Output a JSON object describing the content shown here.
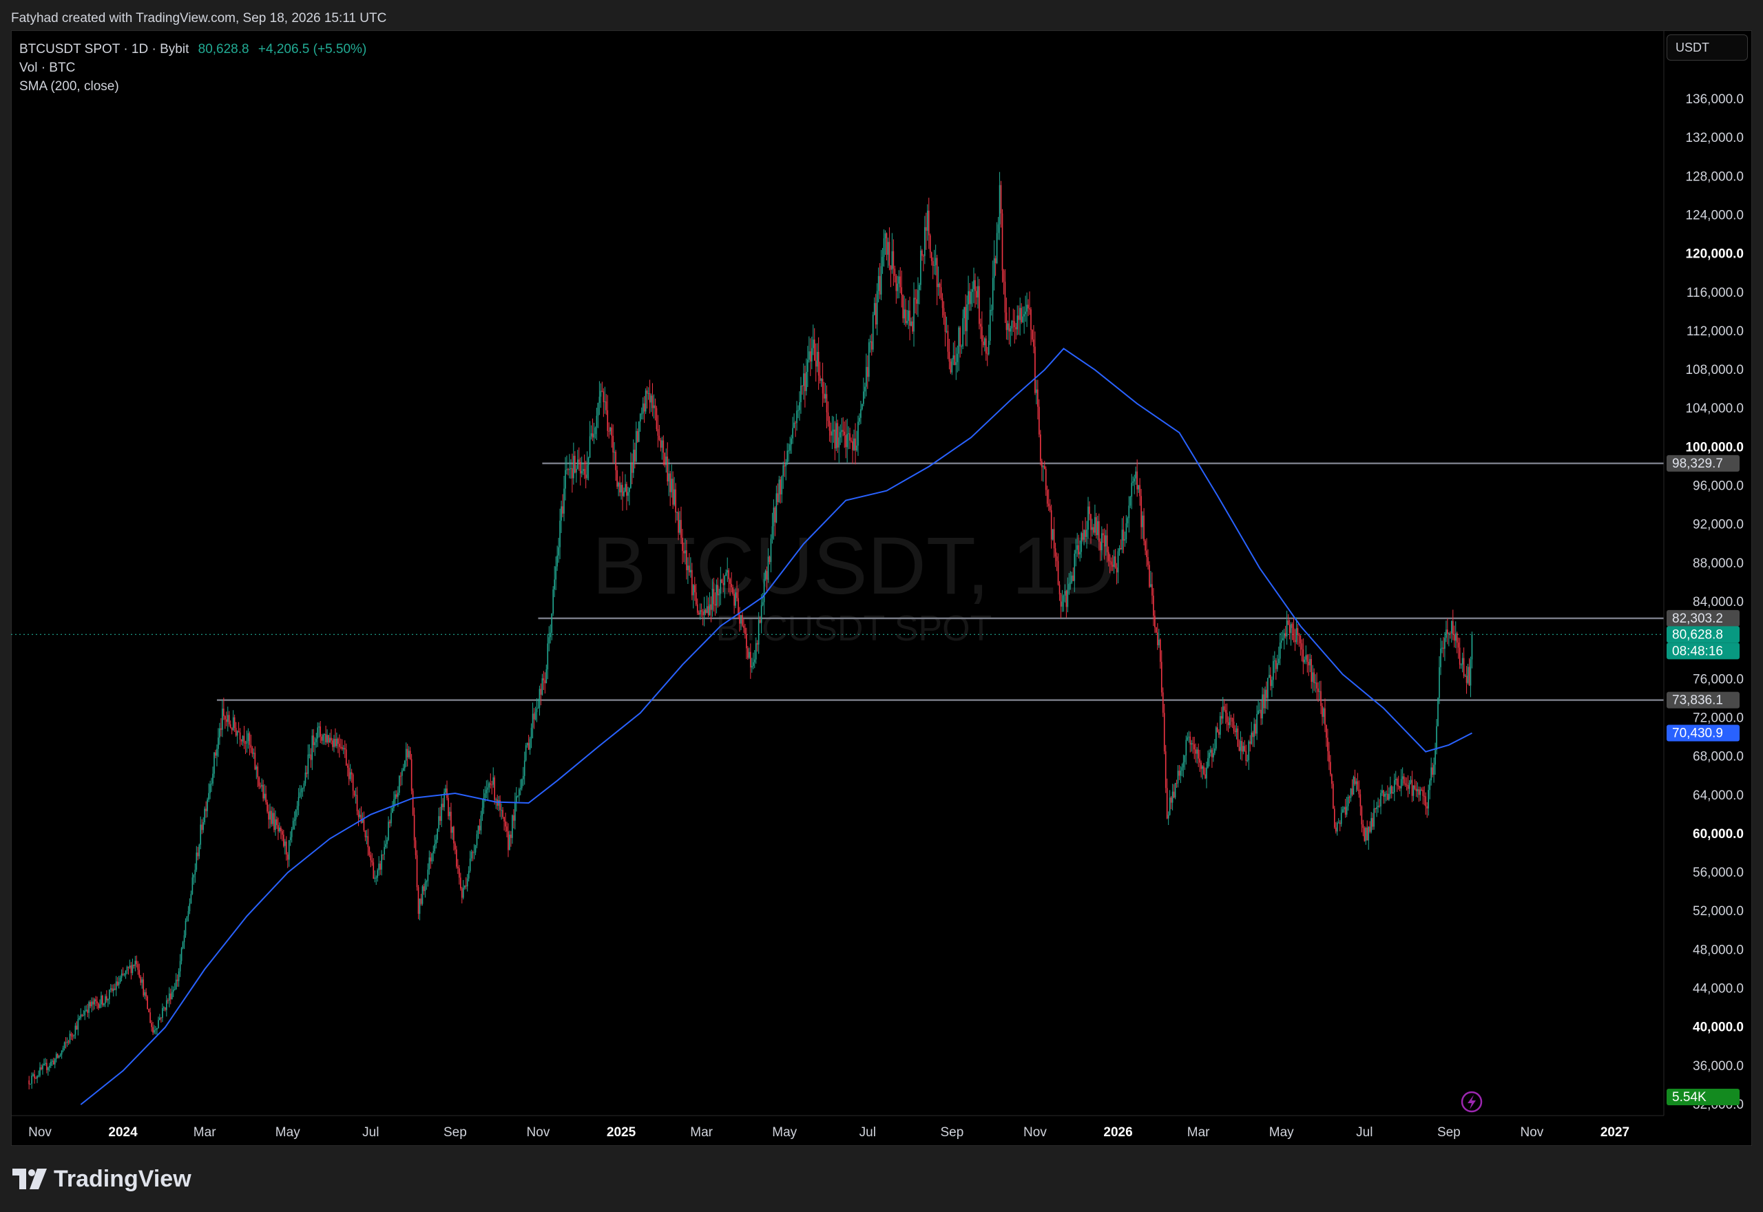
{
  "header": {
    "credit": "Fatyhad created with TradingView.com, Sep 18, 2026 15:11 UTC"
  },
  "legend": {
    "symbol": "BTCUSDT SPOT · 1D · Bybit",
    "last": "80,628.8",
    "change": "+4,206.5 (+5.50%)",
    "vol": "Vol · BTC",
    "sma": "SMA (200, close)"
  },
  "currency": "USDT",
  "watermark": {
    "line1": "BTCUSDT, 1D",
    "line2": "BTCUSDT SPOT"
  },
  "brand": {
    "name": "TradingView"
  },
  "colors": {
    "up": "#22ab94",
    "down": "#f23645",
    "sma": "#2962ff",
    "last_label": "#089981",
    "grid_line": "#787b86"
  },
  "chart_data": {
    "type": "candlestick",
    "ylim": [
      32000,
      140000
    ],
    "y_ticks": [
      {
        "v": 32000,
        "label": "32,000.0",
        "bold": false
      },
      {
        "v": 36000,
        "label": "36,000.0",
        "bold": false
      },
      {
        "v": 40000,
        "label": "40,000.0",
        "bold": true
      },
      {
        "v": 44000,
        "label": "44,000.0",
        "bold": false
      },
      {
        "v": 48000,
        "label": "48,000.0",
        "bold": false
      },
      {
        "v": 52000,
        "label": "52,000.0",
        "bold": false
      },
      {
        "v": 56000,
        "label": "56,000.0",
        "bold": false
      },
      {
        "v": 60000,
        "label": "60,000.0",
        "bold": true
      },
      {
        "v": 64000,
        "label": "64,000.0",
        "bold": false
      },
      {
        "v": 68000,
        "label": "68,000.0",
        "bold": false
      },
      {
        "v": 72000,
        "label": "72,000.0",
        "bold": false
      },
      {
        "v": 76000,
        "label": "76,000.0",
        "bold": false
      },
      {
        "v": 84000,
        "label": "84,000.0",
        "bold": false
      },
      {
        "v": 88000,
        "label": "88,000.0",
        "bold": false
      },
      {
        "v": 92000,
        "label": "92,000.0",
        "bold": false
      },
      {
        "v": 96000,
        "label": "96,000.0",
        "bold": false
      },
      {
        "v": 100000,
        "label": "100,000.0",
        "bold": true
      },
      {
        "v": 104000,
        "label": "104,000.0",
        "bold": false
      },
      {
        "v": 108000,
        "label": "108,000.0",
        "bold": false
      },
      {
        "v": 112000,
        "label": "112,000.0",
        "bold": false
      },
      {
        "v": 116000,
        "label": "116,000.0",
        "bold": false
      },
      {
        "v": 120000,
        "label": "120,000.0",
        "bold": true
      },
      {
        "v": 124000,
        "label": "124,000.0",
        "bold": false
      },
      {
        "v": 128000,
        "label": "128,000.0",
        "bold": false
      },
      {
        "v": 132000,
        "label": "132,000.0",
        "bold": false
      },
      {
        "v": 136000,
        "label": "136,000.0",
        "bold": false
      }
    ],
    "x_ticks": [
      {
        "date": "2023-11-01",
        "label": "Nov",
        "bold": false
      },
      {
        "date": "2024-01-01",
        "label": "2024",
        "bold": true
      },
      {
        "date": "2024-03-01",
        "label": "Mar",
        "bold": false
      },
      {
        "date": "2024-05-01",
        "label": "May",
        "bold": false
      },
      {
        "date": "2024-07-01",
        "label": "Jul",
        "bold": false
      },
      {
        "date": "2024-09-01",
        "label": "Sep",
        "bold": false
      },
      {
        "date": "2024-11-01",
        "label": "Nov",
        "bold": false
      },
      {
        "date": "2025-01-01",
        "label": "2025",
        "bold": true
      },
      {
        "date": "2025-03-01",
        "label": "Mar",
        "bold": false
      },
      {
        "date": "2025-05-01",
        "label": "May",
        "bold": false
      },
      {
        "date": "2025-07-01",
        "label": "Jul",
        "bold": false
      },
      {
        "date": "2025-09-01",
        "label": "Sep",
        "bold": false
      },
      {
        "date": "2025-11-01",
        "label": "Nov",
        "bold": false
      },
      {
        "date": "2026-01-01",
        "label": "2026",
        "bold": true
      },
      {
        "date": "2026-03-01",
        "label": "Mar",
        "bold": false
      },
      {
        "date": "2026-05-01",
        "label": "May",
        "bold": false
      },
      {
        "date": "2026-07-01",
        "label": "Jul",
        "bold": false
      },
      {
        "date": "2026-09-01",
        "label": "Sep",
        "bold": false
      },
      {
        "date": "2026-11-01",
        "label": "Nov",
        "bold": false
      },
      {
        "date": "2027-01-01",
        "label": "2027",
        "bold": true
      }
    ],
    "x_range": [
      "2023-10-22",
      "2027-01-15"
    ],
    "price_path": [
      [
        "2023-10-24",
        34500
      ],
      [
        "2023-11-15",
        37000
      ],
      [
        "2023-12-05",
        42000
      ],
      [
        "2023-12-20",
        43000
      ],
      [
        "2024-01-11",
        47000
      ],
      [
        "2024-01-23",
        39500
      ],
      [
        "2024-02-10",
        45000
      ],
      [
        "2024-02-28",
        61000
      ],
      [
        "2024-03-14",
        72000
      ],
      [
        "2024-04-01",
        70000
      ],
      [
        "2024-04-15",
        63000
      ],
      [
        "2024-05-01",
        58000
      ],
      [
        "2024-05-21",
        70500
      ],
      [
        "2024-06-10",
        69500
      ],
      [
        "2024-07-05",
        55000
      ],
      [
        "2024-07-29",
        69500
      ],
      [
        "2024-08-05",
        52000
      ],
      [
        "2024-08-25",
        64500
      ],
      [
        "2024-09-06",
        53500
      ],
      [
        "2024-09-27",
        66000
      ],
      [
        "2024-10-10",
        59000
      ],
      [
        "2024-10-29",
        72500
      ],
      [
        "2024-11-06",
        76000
      ],
      [
        "2024-11-22",
        98500
      ],
      [
        "2024-12-05",
        97000
      ],
      [
        "2024-12-17",
        106500
      ],
      [
        "2025-01-02",
        94000
      ],
      [
        "2025-01-21",
        106000
      ],
      [
        "2025-02-05",
        97000
      ],
      [
        "2025-02-28",
        82000
      ],
      [
        "2025-03-20",
        87000
      ],
      [
        "2025-04-08",
        77000
      ],
      [
        "2025-04-25",
        94500
      ],
      [
        "2025-05-22",
        111000
      ],
      [
        "2025-06-05",
        101500
      ],
      [
        "2025-06-22",
        100000
      ],
      [
        "2025-07-14",
        121000
      ],
      [
        "2025-08-02",
        112000
      ],
      [
        "2025-08-14",
        123500
      ],
      [
        "2025-09-01",
        108000
      ],
      [
        "2025-09-18",
        117500
      ],
      [
        "2025-09-26",
        109000
      ],
      [
        "2025-10-06",
        125500
      ],
      [
        "2025-10-11",
        111000
      ],
      [
        "2025-10-28",
        115000
      ],
      [
        "2025-11-04",
        101000
      ],
      [
        "2025-11-21",
        83000
      ],
      [
        "2025-12-10",
        93000
      ],
      [
        "2025-12-31",
        87500
      ],
      [
        "2026-01-14",
        97000
      ],
      [
        "2026-02-01",
        78000
      ],
      [
        "2026-02-06",
        62000
      ],
      [
        "2026-02-22",
        70000
      ],
      [
        "2026-03-05",
        66000
      ],
      [
        "2026-03-20",
        73000
      ],
      [
        "2026-04-05",
        68000
      ],
      [
        "2026-04-25",
        77000
      ],
      [
        "2026-05-06",
        82000
      ],
      [
        "2026-05-20",
        78000
      ],
      [
        "2026-06-02",
        72000
      ],
      [
        "2026-06-10",
        60000
      ],
      [
        "2026-06-25",
        66000
      ],
      [
        "2026-07-01",
        59500
      ],
      [
        "2026-07-15",
        64000
      ],
      [
        "2026-08-01",
        65500
      ],
      [
        "2026-08-16",
        63000
      ],
      [
        "2026-08-22",
        69000
      ],
      [
        "2026-08-26",
        79000
      ],
      [
        "2026-09-03",
        81500
      ],
      [
        "2026-09-12",
        77000
      ],
      [
        "2026-09-16",
        76200
      ],
      [
        "2026-09-18",
        80628.8
      ]
    ],
    "sma_path": [
      [
        "2023-12-01",
        32000
      ],
      [
        "2024-01-01",
        35500
      ],
      [
        "2024-02-01",
        40000
      ],
      [
        "2024-03-01",
        46000
      ],
      [
        "2024-04-01",
        51500
      ],
      [
        "2024-05-01",
        56000
      ],
      [
        "2024-06-01",
        59500
      ],
      [
        "2024-07-01",
        62000
      ],
      [
        "2024-08-01",
        63700
      ],
      [
        "2024-09-01",
        64200
      ],
      [
        "2024-10-01",
        63300
      ],
      [
        "2024-10-25",
        63200
      ],
      [
        "2024-11-15",
        65500
      ],
      [
        "2024-12-15",
        69000
      ],
      [
        "2025-01-15",
        72500
      ],
      [
        "2025-02-15",
        77500
      ],
      [
        "2025-03-15",
        81500
      ],
      [
        "2025-04-15",
        84500
      ],
      [
        "2025-05-15",
        90000
      ],
      [
        "2025-06-15",
        94500
      ],
      [
        "2025-07-15",
        95500
      ],
      [
        "2025-08-15",
        98000
      ],
      [
        "2025-09-15",
        101000
      ],
      [
        "2025-10-15",
        105000
      ],
      [
        "2025-11-08",
        108000
      ],
      [
        "2025-11-22",
        110200
      ],
      [
        "2025-12-15",
        108000
      ],
      [
        "2026-01-15",
        104500
      ],
      [
        "2026-02-15",
        101500
      ],
      [
        "2026-03-15",
        95000
      ],
      [
        "2026-04-15",
        87500
      ],
      [
        "2026-05-15",
        81500
      ],
      [
        "2026-06-15",
        76500
      ],
      [
        "2026-07-15",
        73000
      ],
      [
        "2026-08-15",
        68500
      ],
      [
        "2026-09-01",
        69200
      ],
      [
        "2026-09-18",
        70430.9
      ]
    ],
    "levels": [
      {
        "name": "resistance",
        "value": 98329.7,
        "label": "98,329.7",
        "start": "2024-11-04"
      },
      {
        "name": "mid",
        "value": 82303.2,
        "label": "82,303.2",
        "start": "2024-11-01"
      },
      {
        "name": "support",
        "value": 73836.1,
        "label": "73,836.1",
        "start": "2024-03-10"
      }
    ],
    "last_price": {
      "value": 80628.8,
      "label": "80,628.8",
      "countdown": "08:48:16"
    },
    "sma_last": {
      "value": 70430.9,
      "label": "70,430.9"
    },
    "volume_last": {
      "label": "5.54K"
    }
  }
}
